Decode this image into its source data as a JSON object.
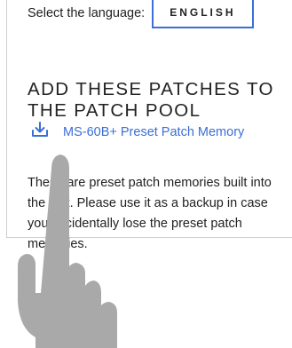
{
  "language": {
    "label": "Select the language:",
    "selected": "ENGLISH"
  },
  "heading": "ADD THESE PATCHES TO THE PATCH POOL",
  "download": {
    "icon": "download-icon",
    "link_text": "MS-60B+ Preset Patch Memory"
  },
  "description": "These are preset patch memories built into the unit. Please use it as a backup in case you accidentally lose the preset patch memories.",
  "colors": {
    "accent": "#3b6fd6",
    "hand": "#a9a9a9"
  }
}
